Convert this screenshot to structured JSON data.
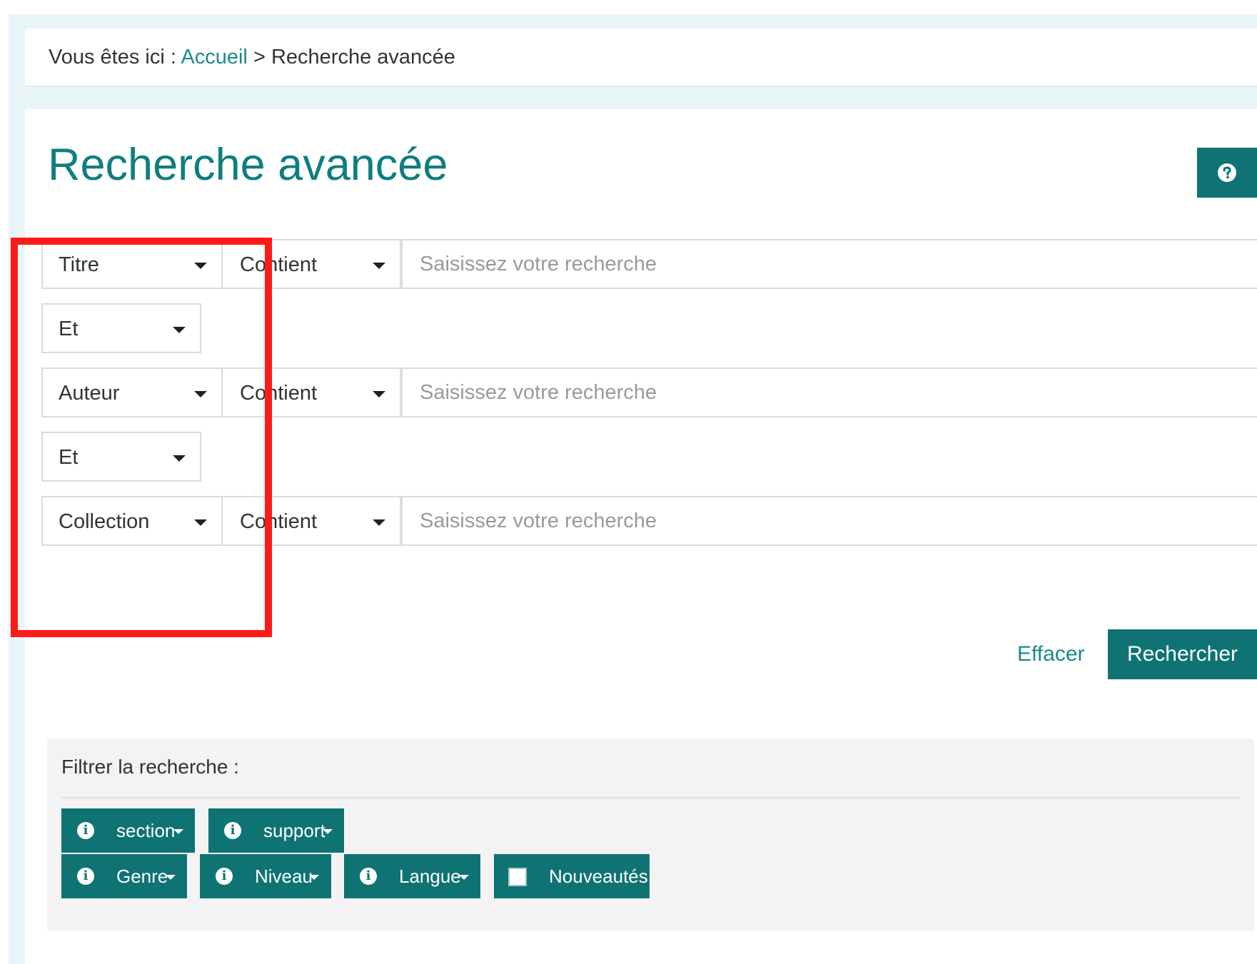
{
  "breadcrumb": {
    "prefix": "Vous êtes ici : ",
    "home": "Accueil",
    "separator": " > ",
    "current": "Recherche avancée"
  },
  "page": {
    "title": "Recherche avancée",
    "help_icon": "question-circle-icon"
  },
  "search_rows": [
    {
      "field": "Titre",
      "operator": "Contient",
      "placeholder": "Saisissez votre recherche"
    },
    {
      "field": "Auteur",
      "operator": "Contient",
      "placeholder": "Saisissez votre recherche"
    },
    {
      "field": "Collection",
      "operator": "Contient",
      "placeholder": "Saisissez votre recherche"
    }
  ],
  "connectors": [
    "Et",
    "Et"
  ],
  "actions": {
    "clear_label": "Effacer",
    "search_label": "Rechercher"
  },
  "filters": {
    "title": "Filtrer la recherche :",
    "buttons": [
      {
        "label": "section",
        "icon": "info-icon"
      },
      {
        "label": "support",
        "icon": "info-icon"
      },
      {
        "label": "Genre",
        "icon": "info-icon"
      },
      {
        "label": "Niveau",
        "icon": "info-icon"
      },
      {
        "label": "Langue",
        "icon": "info-icon"
      }
    ],
    "checkbox_label": "Nouveautés",
    "checkbox_checked": false
  },
  "colors": {
    "accent": "#0f7373",
    "link": "#1b8a8a",
    "highlight": "#ff1a1a",
    "page_background": "#e8f6f8"
  }
}
